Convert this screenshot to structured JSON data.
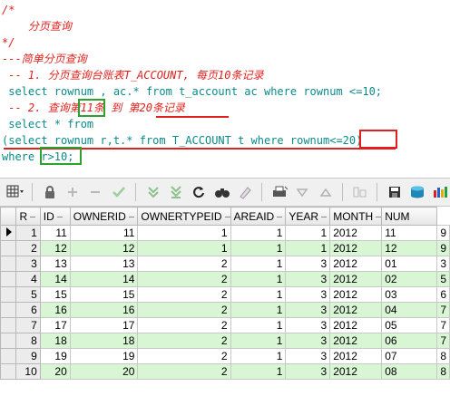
{
  "editor": {
    "line1": "/*",
    "line2": "    分页查询",
    "line3": "*/",
    "line4": "---简单分页查询",
    "line5": " -- 1. 分页查询台账表T_ACCOUNT, 每页10条记录",
    "line6": " select rownum , ac.* from t_account ac where rownum <=10;",
    "line7": " -- 2. 查询第11条 到 第20条记录",
    "line8": " select * from",
    "line9": "(select rownum r,t.* from T_ACCOUNT t where rownum<=20)",
    "line10": "where r>10;"
  },
  "toolbar": {
    "icons": [
      "grid-menu-icon",
      "lock-icon",
      "add-row-icon",
      "delete-row-icon",
      "post-check-icon",
      "fetch-next-icon",
      "fetch-last-icon",
      "refresh-icon",
      "find-icon",
      "clear-icon",
      "print-icon",
      "filter-down-icon",
      "filter-up-icon",
      "chart-icon",
      "save-icon",
      "export-icon",
      "bar-chart-icon"
    ]
  },
  "grid": {
    "columns": [
      "R",
      "ID",
      "OWNERID",
      "OWNERTYPEID",
      "AREAID",
      "YEAR",
      "MONTH",
      "NUM"
    ],
    "rows": [
      [
        "1",
        "11",
        "11",
        "1",
        "1",
        "1",
        "2012",
        "11",
        "9"
      ],
      [
        "2",
        "12",
        "12",
        "1",
        "1",
        "1",
        "2012",
        "12",
        "9"
      ],
      [
        "3",
        "13",
        "13",
        "2",
        "1",
        "3",
        "2012",
        "01",
        "3"
      ],
      [
        "4",
        "14",
        "14",
        "2",
        "1",
        "3",
        "2012",
        "02",
        "5"
      ],
      [
        "5",
        "15",
        "15",
        "2",
        "1",
        "3",
        "2012",
        "03",
        "6"
      ],
      [
        "6",
        "16",
        "16",
        "2",
        "1",
        "3",
        "2012",
        "04",
        "7"
      ],
      [
        "7",
        "17",
        "17",
        "2",
        "1",
        "3",
        "2012",
        "05",
        "7"
      ],
      [
        "8",
        "18",
        "18",
        "2",
        "1",
        "3",
        "2012",
        "06",
        "7"
      ],
      [
        "9",
        "19",
        "19",
        "2",
        "1",
        "3",
        "2012",
        "07",
        "8"
      ],
      [
        "10",
        "20",
        "20",
        "2",
        "1",
        "3",
        "2012",
        "08",
        "8"
      ]
    ]
  },
  "colors": {
    "comment": "#e0201c",
    "code": "#0a8a8a",
    "alt_row": "#d8f5d4",
    "highlight_box": "#2ea02e"
  }
}
